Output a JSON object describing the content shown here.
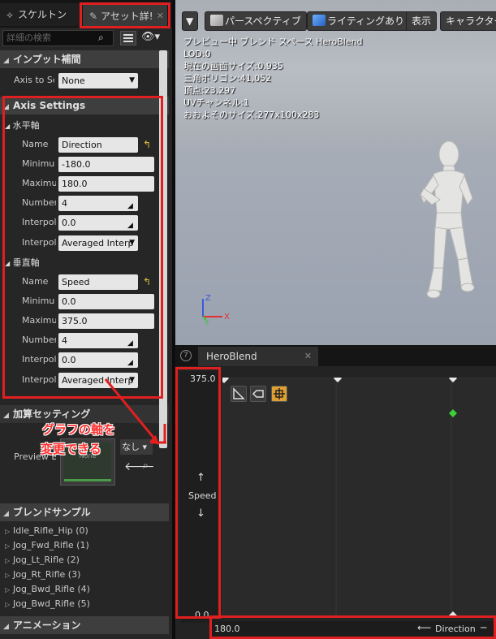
{
  "tabs": [
    {
      "label": "スケルトン",
      "icon": "skeleton-icon"
    },
    {
      "label": "アセット詳!",
      "icon": "asset-details-icon"
    }
  ],
  "search": {
    "placeholder": "詳細の検索"
  },
  "categories": {
    "input_interp": "インプット補間",
    "axis_settings": "Axis Settings",
    "additive": "加算セッティング",
    "blend_samples": "ブレンドサンプル",
    "animation": "アニメーション"
  },
  "axis_to_scale": {
    "label": "Axis to Sc",
    "value": "None"
  },
  "horizontal": {
    "title": "水平軸",
    "name": {
      "label": "Name",
      "value": "Direction"
    },
    "min": {
      "label": "Minimu",
      "value": "-180.0"
    },
    "max": {
      "label": "Maximu",
      "value": "180.0"
    },
    "divisions": {
      "label": "Number",
      "value": "4"
    },
    "interp_time": {
      "label": "Interpola",
      "value": "0.0"
    },
    "interp_type": {
      "label": "Interpola",
      "value": "Averaged Interp"
    }
  },
  "vertical": {
    "title": "垂直軸",
    "name": {
      "label": "Name",
      "value": "Speed"
    },
    "min": {
      "label": "Minimu",
      "value": "0.0"
    },
    "max": {
      "label": "Maximu",
      "value": "375.0"
    },
    "divisions": {
      "label": "Number",
      "value": "4"
    },
    "interp_time": {
      "label": "Interpola",
      "value": "0.0"
    },
    "interp_type": {
      "label": "Interpola",
      "value": "Averaged Interp"
    }
  },
  "preview": {
    "label": "Preview B",
    "thumb_text": "None",
    "select_value": "なし"
  },
  "samples": [
    "Idle_Rifle_Hip (0)",
    "Jog_Fwd_Rifle (1)",
    "Jog_Lt_Rifle (2)",
    "Jog_Rt_Rifle (3)",
    "Jog_Bwd_Rifle (4)",
    "Jog_Bwd_Rifle (5)"
  ],
  "viewport": {
    "toolbar": [
      "パースペクティブ",
      "ライティングあり",
      "表示",
      "キャラクター"
    ],
    "info": [
      "プレビュー中 ブレンド スペース HeroBlend",
      "LOD:0",
      "現在の画面サイズ:0.935",
      "三角ポリゴン:41,052",
      "頂点:23,297",
      "UVチャンネル:1",
      "おおよそのサイズ:277x100x283"
    ],
    "axis_labels": {
      "z": "Z",
      "y": "Y",
      "x": "X"
    }
  },
  "graph": {
    "tab_label": "HeroBlend",
    "y_max": "375.0",
    "y_min": "0.0",
    "y_name": "Speed",
    "x_min_label": "180.0",
    "x_name": "Direction"
  },
  "annotation": {
    "line1": "グラフの軸を",
    "line2": "変更できる"
  },
  "colors": {
    "highlight": "#e02020",
    "accent": "#e0a030",
    "sample_point": "#3ad13a"
  }
}
